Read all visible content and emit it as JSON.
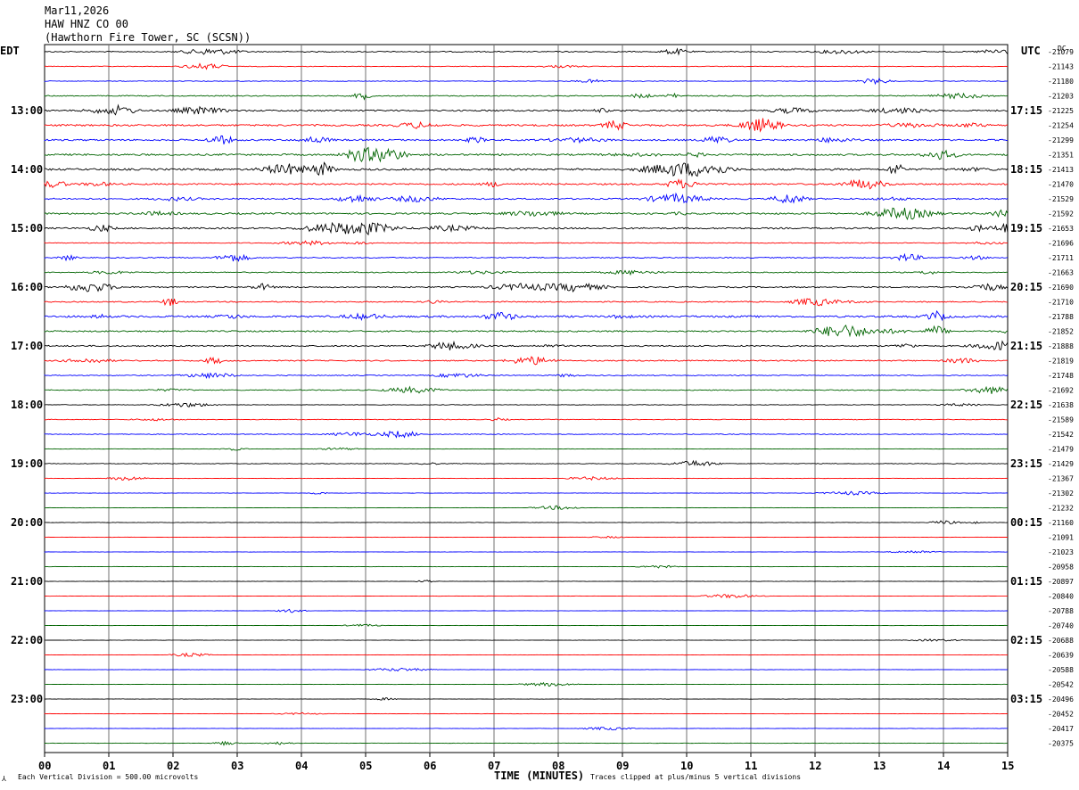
{
  "header": {
    "date": "Mar11,2026",
    "channel": "HAW HNZ CO 00",
    "station": "(Hawthorn Fire Tower, SC (SCSN))"
  },
  "left_axis_label": "EDT",
  "right_axis_label": "UTC",
  "dc_label": "DC",
  "footer": {
    "scale_note": "Each Vertical Division =  500.00 microvolts",
    "axis_title": "TIME (MINUTES)",
    "clip_note": "Traces clipped at plus/minus 5 vertical divisions"
  },
  "chart_data": {
    "type": "line",
    "xlabel": "TIME (MINUTES)",
    "xlim": [
      0,
      15
    ],
    "x_ticks": [
      "00",
      "01",
      "02",
      "03",
      "04",
      "05",
      "06",
      "07",
      "08",
      "09",
      "10",
      "11",
      "12",
      "13",
      "14",
      "15"
    ],
    "trace_minutes_per_line": 15,
    "trace_colors": [
      "#000000",
      "#ff0000",
      "#0000ff",
      "#006400"
    ],
    "left_time_labels": [
      {
        "row": 4,
        "label": "13:00"
      },
      {
        "row": 8,
        "label": "14:00"
      },
      {
        "row": 12,
        "label": "15:00"
      },
      {
        "row": 16,
        "label": "16:00"
      },
      {
        "row": 20,
        "label": "17:00"
      },
      {
        "row": 24,
        "label": "18:00"
      },
      {
        "row": 28,
        "label": "19:00"
      },
      {
        "row": 32,
        "label": "20:00"
      },
      {
        "row": 36,
        "label": "21:00"
      },
      {
        "row": 40,
        "label": "22:00"
      },
      {
        "row": 44,
        "label": "23:00"
      }
    ],
    "right_time_labels": [
      {
        "row": 4,
        "label": "17:15"
      },
      {
        "row": 8,
        "label": "18:15"
      },
      {
        "row": 12,
        "label": "19:15"
      },
      {
        "row": 16,
        "label": "20:15"
      },
      {
        "row": 20,
        "label": "21:15"
      },
      {
        "row": 24,
        "label": "22:15"
      },
      {
        "row": 28,
        "label": "23:15"
      },
      {
        "row": 32,
        "label": "00:15"
      },
      {
        "row": 36,
        "label": "01:15"
      },
      {
        "row": 40,
        "label": "02:15"
      },
      {
        "row": 44,
        "label": "03:15"
      }
    ],
    "dc_offsets": [
      "-21079",
      "-21143",
      "-21180",
      "-21203",
      "-21225",
      "-21254",
      "-21299",
      "-21351",
      "-21413",
      "-21470",
      "-21529",
      "-21592",
      "-21653",
      "-21696",
      "-21711",
      "-21663",
      "-21690",
      "-21710",
      "-21788",
      "-21852",
      "-21888",
      "-21819",
      "-21748",
      "-21692",
      "-21638",
      "-21589",
      "-21542",
      "-21479",
      "-21429",
      "-21367",
      "-21302",
      "-21232",
      "-21160",
      "-21091",
      "-21023",
      "-20958",
      "-20897",
      "-20840",
      "-20788",
      "-20740",
      "-20688",
      "-20639",
      "-20588",
      "-20542",
      "-20496",
      "-20452",
      "-20417",
      "-20375"
    ],
    "activity_level": [
      0.9,
      0.6,
      0.6,
      0.9,
      1.4,
      1.6,
      1.5,
      1.6,
      1.7,
      1.4,
      1.4,
      1.5,
      1.4,
      0.7,
      0.9,
      0.9,
      1.2,
      1.0,
      1.7,
      1.3,
      1.2,
      1.0,
      0.8,
      0.8,
      0.5,
      0.6,
      0.7,
      0.4,
      0.6,
      0.4,
      0.4,
      0.3,
      0.4,
      0.3,
      0.3,
      0.3,
      0.3,
      0.3,
      0.3,
      0.3,
      0.3,
      0.3,
      0.3,
      0.3,
      0.3,
      0.3,
      0.3,
      0.4
    ]
  }
}
